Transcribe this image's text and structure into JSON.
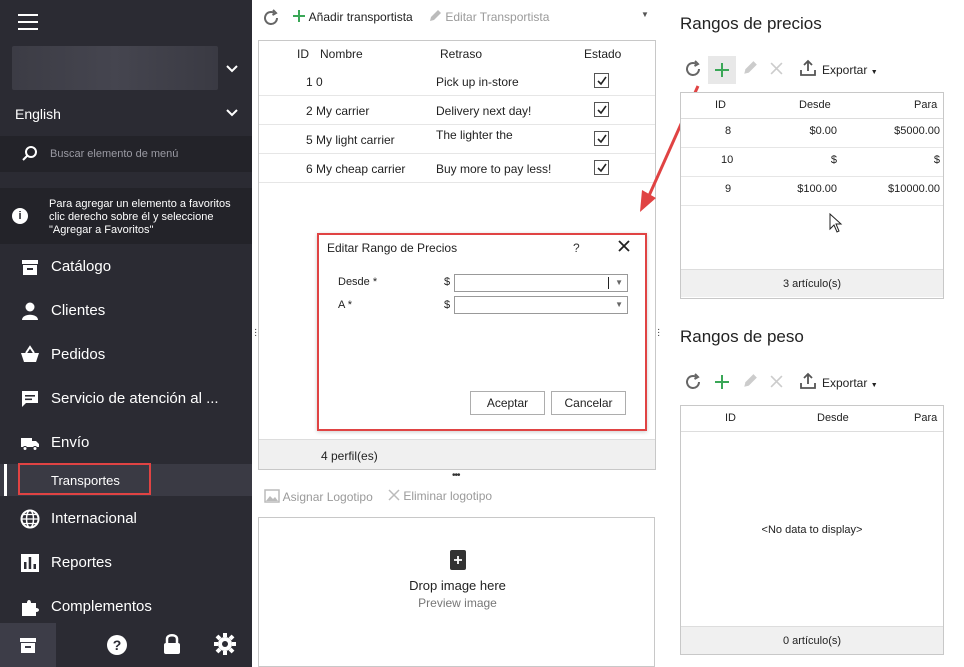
{
  "sidebar": {
    "language": "English",
    "search_placeholder": "Buscar elemento de menú",
    "favorites_tip": "Para agregar un elemento a favoritos clic derecho sobre él y seleccione \"Agregar a Favoritos\"",
    "items": [
      {
        "label": "Catálogo",
        "icon": "store-icon"
      },
      {
        "label": "Clientes",
        "icon": "person-icon"
      },
      {
        "label": "Pedidos",
        "icon": "basket-icon"
      },
      {
        "label": "Servicio de atención al ...",
        "icon": "chat-icon"
      },
      {
        "label": "Envío",
        "icon": "truck-icon"
      },
      {
        "label": "Internacional",
        "icon": "globe-icon"
      },
      {
        "label": "Reportes",
        "icon": "chart-icon"
      },
      {
        "label": "Complementos",
        "icon": "puzzle-icon"
      }
    ],
    "active_subitem": "Transportes"
  },
  "carriers": {
    "toolbar": {
      "add": "Añadir transportista",
      "edit": "Editar Transportista"
    },
    "columns": {
      "id": "ID",
      "name": "Nombre",
      "delay": "Retraso",
      "status": "Estado"
    },
    "rows": [
      {
        "id": "1",
        "name": "0",
        "delay": "Pick up in-store",
        "status": true
      },
      {
        "id": "2",
        "name": "My carrier",
        "delay": "Delivery next day!",
        "status": true
      },
      {
        "id": "5",
        "name": "My light carrier",
        "delay": "The lighter the",
        "status": true
      },
      {
        "id": "6",
        "name": "My cheap carrier",
        "delay": "Buy more to pay less!",
        "status": true
      }
    ],
    "footer": "4 perfil(es)"
  },
  "logo": {
    "assign": "Asignar Logotipo",
    "remove": "Eliminar logotipo",
    "drop": "Drop image here",
    "preview": "Preview image"
  },
  "dialog": {
    "title": "Editar Rango de Precios",
    "help": "?",
    "from_label": "Desde *",
    "to_label": "A *",
    "currency": "$",
    "from_value": "",
    "to_value": "",
    "ok": "Aceptar",
    "cancel": "Cancelar"
  },
  "price_ranges": {
    "title": "Rangos de precios",
    "export": "Exportar",
    "columns": {
      "id": "ID",
      "from": "Desde",
      "to": "Para"
    },
    "rows": [
      {
        "id": "8",
        "from": "$0.00",
        "to": "$5000.00"
      },
      {
        "id": "10",
        "from": "$",
        "to": "$"
      },
      {
        "id": "9",
        "from": "$100.00",
        "to": "$10000.00"
      }
    ],
    "footer": "3 artículo(s)"
  },
  "weight_ranges": {
    "title": "Rangos de peso",
    "export": "Exportar",
    "columns": {
      "id": "ID",
      "from": "Desde",
      "to": "Para"
    },
    "empty": "<No data to display>",
    "footer": "0 artículo(s)"
  },
  "colors": {
    "sidebar_bg": "#2b2b33",
    "highlight_red": "#e04343",
    "add_green": "#3aa757"
  }
}
